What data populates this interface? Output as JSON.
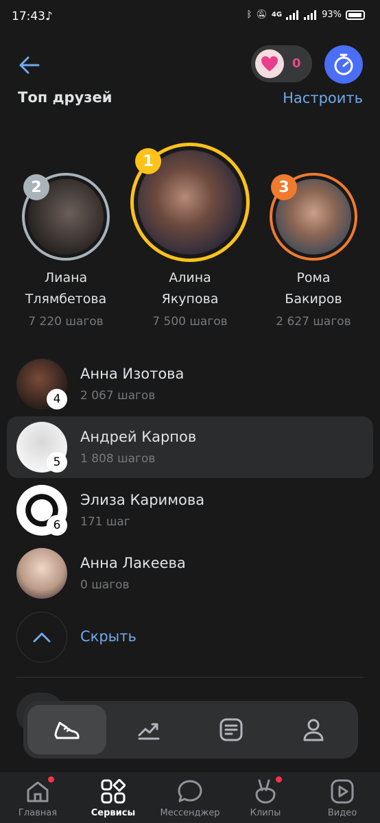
{
  "status_bar": {
    "time": "17:43",
    "network": "4G",
    "battery": "93%"
  },
  "header": {
    "likes_count": "0"
  },
  "section": {
    "title": "Топ друзей",
    "configure_label": "Настроить"
  },
  "podium": [
    {
      "rank": "2",
      "name_line1": "Лиана",
      "name_line2": "Тлямбетова",
      "steps": "7 220 шагов"
    },
    {
      "rank": "1",
      "name_line1": "Алина",
      "name_line2": "Якупова",
      "steps": "7 500 шагов"
    },
    {
      "rank": "3",
      "name_line1": "Рома",
      "name_line2": "Бакиров",
      "steps": "2 627 шагов"
    }
  ],
  "list": [
    {
      "place": "4",
      "name": "Анна Изотова",
      "steps": "2 067 шагов"
    },
    {
      "place": "5",
      "name": "Андрей Карпов",
      "steps": "1 808 шагов"
    },
    {
      "place": "6",
      "name": "Элиза Каримова",
      "steps": "171 шаг"
    },
    {
      "place": "",
      "name": "Анна Лакеева",
      "steps": "0 шагов"
    }
  ],
  "hide_label": "Скрыть",
  "subtabs": [
    {
      "icon": "sneaker-icon"
    },
    {
      "icon": "trend-chart-icon"
    },
    {
      "icon": "document-list-icon"
    },
    {
      "icon": "profile-icon"
    }
  ],
  "bottom_nav": [
    {
      "label": "Главная",
      "icon": "home-icon"
    },
    {
      "label": "Сервисы",
      "icon": "services-grid-icon"
    },
    {
      "label": "Мессенджер",
      "icon": "chat-bubble-icon"
    },
    {
      "label": "Клипы",
      "icon": "clips-icon"
    },
    {
      "label": "Видео",
      "icon": "video-play-icon"
    }
  ],
  "colors": {
    "accent_blue": "#71aaeb",
    "gold": "#ffc21a",
    "silver": "#a9b3ba",
    "bronze": "#f07a2e",
    "likes_pink": "#e64a8d",
    "timer_blue": "#4a6ef5",
    "notification_red": "#ff3347"
  }
}
